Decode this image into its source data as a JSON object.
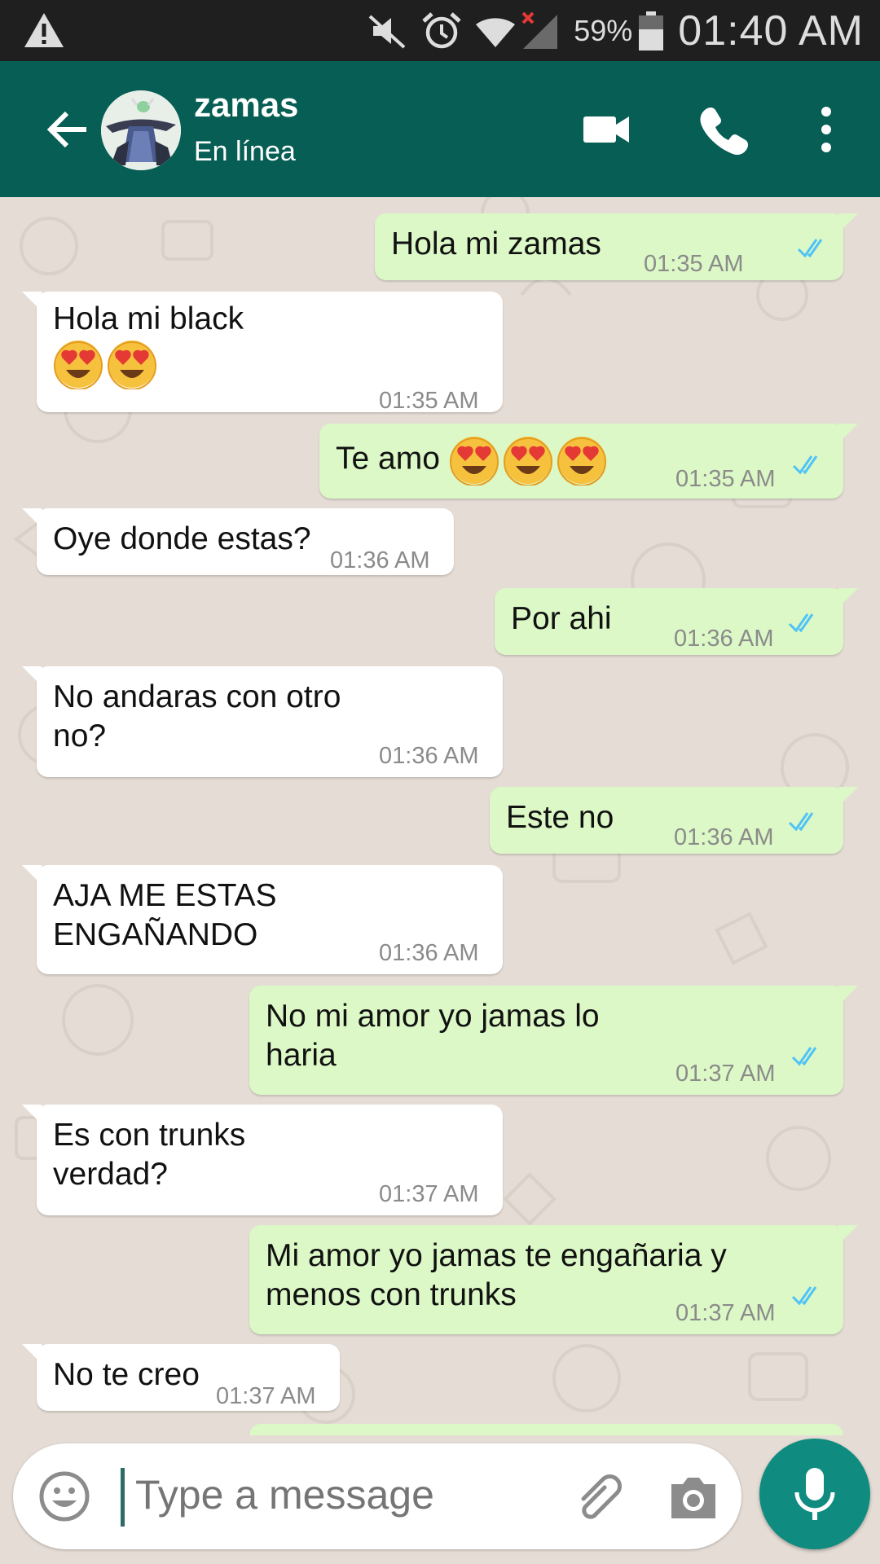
{
  "status_bar": {
    "battery_percent": "59%",
    "time": "01:40 AM",
    "icons": [
      "warning-icon",
      "mute-icon",
      "alarm-icon",
      "wifi-icon",
      "signal-icon",
      "battery-icon"
    ]
  },
  "header": {
    "contact_name": "zamas",
    "contact_status": "En línea",
    "icons": [
      "back-arrow-icon",
      "video-call-icon",
      "voice-call-icon",
      "more-options-icon"
    ],
    "color": "#075e54"
  },
  "messages": [
    {
      "dir": "out",
      "text": "Hola mi zamas",
      "time": "01:35 AM",
      "read": true
    },
    {
      "dir": "in",
      "text": "Hola mi black",
      "emoji": [
        "heart-eyes-emoji",
        "heart-eyes-emoji"
      ],
      "time": "01:35 AM"
    },
    {
      "dir": "out",
      "text": "Te amo",
      "emoji": [
        "heart-eyes-emoji",
        "heart-eyes-emoji",
        "heart-eyes-emoji"
      ],
      "time": "01:35 AM",
      "read": true
    },
    {
      "dir": "in",
      "text": "Oye donde estas?",
      "time": "01:36 AM"
    },
    {
      "dir": "out",
      "text": "Por ahi",
      "time": "01:36 AM",
      "read": true
    },
    {
      "dir": "in",
      "text": "No andaras con otro\nno?",
      "time": "01:36 AM"
    },
    {
      "dir": "out",
      "text": "Este no",
      "time": "01:36 AM",
      "read": true
    },
    {
      "dir": "in",
      "text": "AJA ME ESTAS\nENGAÑANDO",
      "time": "01:36 AM"
    },
    {
      "dir": "out",
      "text": "No mi amor yo jamas lo\nharia",
      "time": "01:37 AM",
      "read": true
    },
    {
      "dir": "in",
      "text": "Es con trunks\nverdad?",
      "time": "01:37 AM"
    },
    {
      "dir": "out",
      "text": "Mi amor yo jamas te engañaria y\nmenos con trunks",
      "time": "01:37 AM",
      "read": true
    },
    {
      "dir": "in",
      "text": "No te creo",
      "time": "01:37 AM"
    }
  ],
  "composer": {
    "placeholder": "Type a message",
    "icons": [
      "emoji-icon",
      "attach-icon",
      "camera-icon",
      "mic-icon"
    ],
    "accent": "#0f8c7f"
  },
  "colors": {
    "incoming_bubble": "#ffffff",
    "outgoing_bubble": "#dcf8c6",
    "chat_background": "#e5ddd5",
    "read_ticks": "#4fc3f7"
  }
}
